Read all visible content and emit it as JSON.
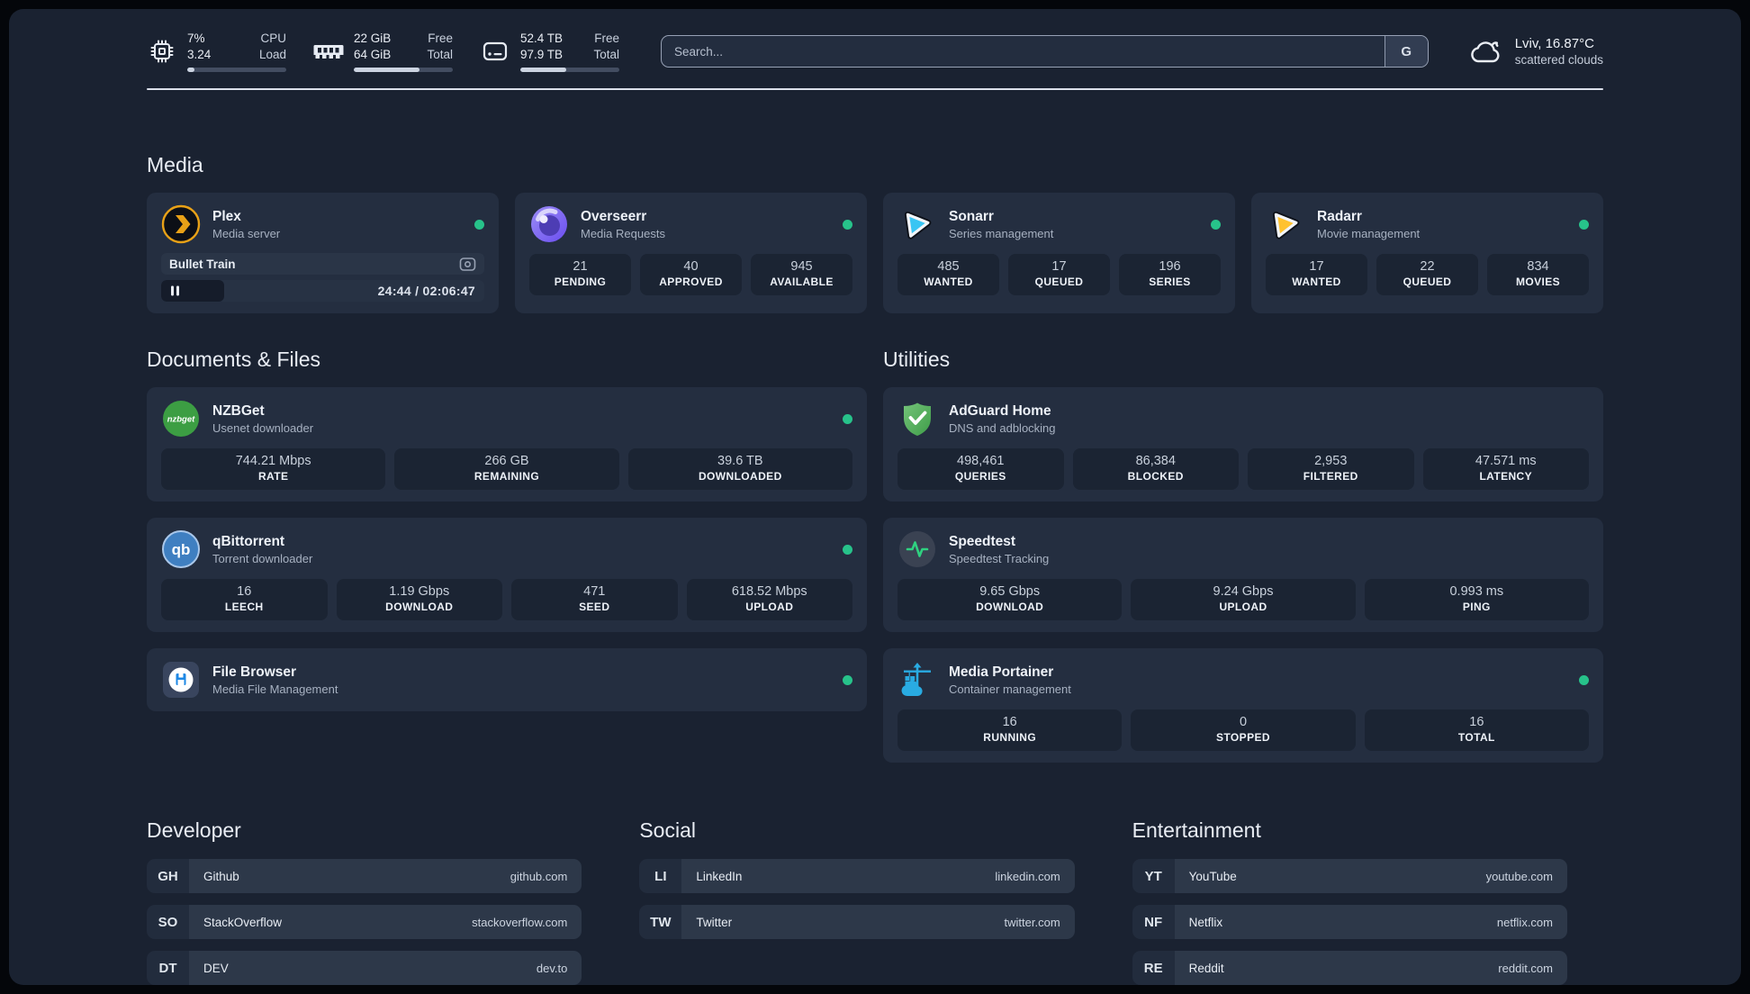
{
  "colors": {
    "status_online": "#27c28a",
    "divider": "#dbe0ea",
    "accent_plex": "#e8a117",
    "accent_overseerr": "#7c64ee",
    "accent_sonarr": "#39c5f3",
    "accent_radarr": "#ffc230",
    "accent_nzbget": "#3c9e43",
    "accent_qbittorrent": "#3f7fc1",
    "accent_filebrowser": "#1e88e5",
    "accent_adguard": "#57b05f",
    "accent_speedtest": "#2fd180",
    "accent_portainer": "#29abe2"
  },
  "topbar": {
    "cpu": {
      "value_top": "7%",
      "value_bottom": "3.24",
      "label_top": "CPU",
      "label_bottom": "Load",
      "progress": "7%"
    },
    "memory": {
      "value_top": "22 GiB",
      "value_bottom": "64 GiB",
      "label_top": "Free",
      "label_bottom": "Total",
      "progress": "66%"
    },
    "storage": {
      "value_top": "52.4 TB",
      "value_bottom": "97.9 TB",
      "label_top": "Free",
      "label_bottom": "Total",
      "progress": "46%"
    },
    "search": {
      "placeholder": "Search...",
      "engine_button": "G"
    },
    "weather": {
      "location_temp": "Lviv, 16.87°C",
      "condition": "scattered clouds"
    }
  },
  "sections": {
    "media": {
      "title": "Media",
      "plex": {
        "name": "Plex",
        "desc": "Media server",
        "now_playing": {
          "title": "Bullet Train",
          "time": "24:44 / 02:06:47",
          "progress": "19.5%"
        }
      },
      "overseerr": {
        "name": "Overseerr",
        "desc": "Media Requests",
        "stats": [
          {
            "value": "21",
            "label": "PENDING"
          },
          {
            "value": "40",
            "label": "APPROVED"
          },
          {
            "value": "945",
            "label": "AVAILABLE"
          }
        ]
      },
      "sonarr": {
        "name": "Sonarr",
        "desc": "Series management",
        "stats": [
          {
            "value": "485",
            "label": "WANTED"
          },
          {
            "value": "17",
            "label": "QUEUED"
          },
          {
            "value": "196",
            "label": "SERIES"
          }
        ]
      },
      "radarr": {
        "name": "Radarr",
        "desc": "Movie management",
        "stats": [
          {
            "value": "17",
            "label": "WANTED"
          },
          {
            "value": "22",
            "label": "QUEUED"
          },
          {
            "value": "834",
            "label": "MOVIES"
          }
        ]
      }
    },
    "documents": {
      "title": "Documents & Files",
      "nzbget": {
        "name": "NZBGet",
        "desc": "Usenet downloader",
        "icon_text": "nzbget",
        "stats": [
          {
            "value": "744.21 Mbps",
            "label": "RATE"
          },
          {
            "value": "266 GB",
            "label": "REMAINING"
          },
          {
            "value": "39.6 TB",
            "label": "DOWNLOADED"
          }
        ]
      },
      "qbittorrent": {
        "name": "qBittorrent",
        "desc": "Torrent downloader",
        "icon_text": "qb",
        "stats": [
          {
            "value": "16",
            "label": "LEECH"
          },
          {
            "value": "1.19 Gbps",
            "label": "DOWNLOAD"
          },
          {
            "value": "471",
            "label": "SEED"
          },
          {
            "value": "618.52 Mbps",
            "label": "UPLOAD"
          }
        ]
      },
      "filebrowser": {
        "name": "File Browser",
        "desc": "Media File Management"
      }
    },
    "utilities": {
      "title": "Utilities",
      "adguard": {
        "name": "AdGuard Home",
        "desc": "DNS and adblocking",
        "stats": [
          {
            "value": "498,461",
            "label": "QUERIES"
          },
          {
            "value": "86,384",
            "label": "BLOCKED"
          },
          {
            "value": "2,953",
            "label": "FILTERED"
          },
          {
            "value": "47.571 ms",
            "label": "LATENCY"
          }
        ]
      },
      "speedtest": {
        "name": "Speedtest",
        "desc": "Speedtest Tracking",
        "stats": [
          {
            "value": "9.65 Gbps",
            "label": "DOWNLOAD"
          },
          {
            "value": "9.24 Gbps",
            "label": "UPLOAD"
          },
          {
            "value": "0.993 ms",
            "label": "PING"
          }
        ]
      },
      "portainer": {
        "name": "Media Portainer",
        "desc": "Container management",
        "stats": [
          {
            "value": "16",
            "label": "RUNNING"
          },
          {
            "value": "0",
            "label": "STOPPED"
          },
          {
            "value": "16",
            "label": "TOTAL"
          }
        ]
      }
    },
    "links": {
      "developer": {
        "title": "Developer",
        "items": [
          {
            "abbr": "GH",
            "name": "Github",
            "url": "github.com"
          },
          {
            "abbr": "SO",
            "name": "StackOverflow",
            "url": "stackoverflow.com"
          },
          {
            "abbr": "DT",
            "name": "DEV",
            "url": "dev.to"
          }
        ]
      },
      "social": {
        "title": "Social",
        "items": [
          {
            "abbr": "LI",
            "name": "LinkedIn",
            "url": "linkedin.com"
          },
          {
            "abbr": "TW",
            "name": "Twitter",
            "url": "twitter.com"
          }
        ]
      },
      "entertainment": {
        "title": "Entertainment",
        "items": [
          {
            "abbr": "YT",
            "name": "YouTube",
            "url": "youtube.com"
          },
          {
            "abbr": "NF",
            "name": "Netflix",
            "url": "netflix.com"
          },
          {
            "abbr": "RE",
            "name": "Reddit",
            "url": "reddit.com"
          }
        ]
      }
    }
  }
}
